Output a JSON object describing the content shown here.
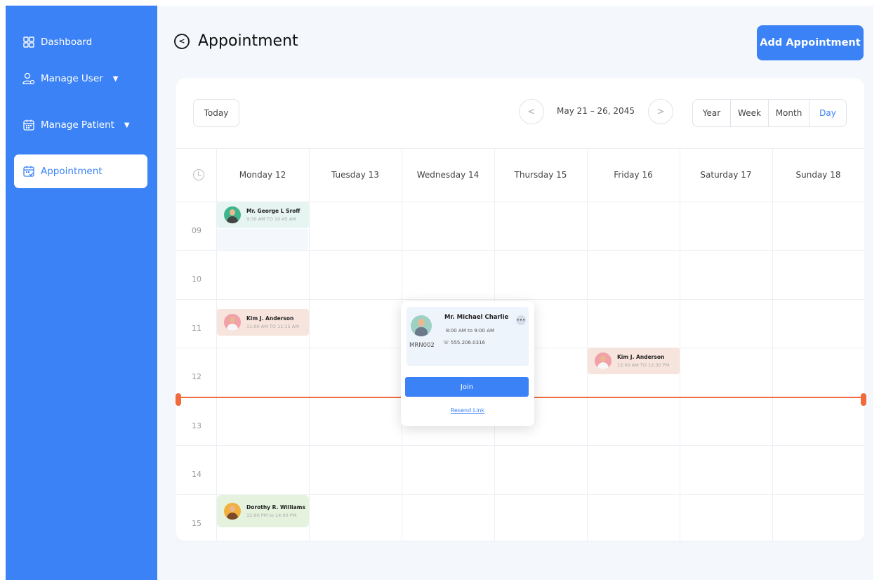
{
  "sidebar": {
    "items": [
      {
        "label": "Dashboard",
        "icon": "dashboard-grid-icon"
      },
      {
        "label": "Manage User",
        "icon": "user-gear-icon",
        "has_chevron": true
      },
      {
        "label": "Manage Patient",
        "icon": "calendar-patient-icon",
        "has_chevron": true
      },
      {
        "label": "Appointment",
        "icon": "calendar-check-icon",
        "active": true
      }
    ]
  },
  "header": {
    "title": "Appointment",
    "add_button": "Add Appointment"
  },
  "toolbar": {
    "today": "Today",
    "date_range": "May 21 – 26, 2045",
    "views": [
      "Year",
      "Week",
      "Month",
      "Day"
    ],
    "selected_view": "Day"
  },
  "calendar": {
    "days": [
      "Monday 12",
      "Tuesday 13",
      "Wednesday 14",
      "Thursday 15",
      "Friday 16",
      "Saturday 17",
      "Sunday 18"
    ],
    "hours": [
      "09",
      "10",
      "11",
      "12",
      "13",
      "14",
      "15"
    ],
    "current_time_hour": "14"
  },
  "appointments": [
    {
      "name": "Mr. George L Sroff",
      "time": "9:30 AM TO 10:45 AM",
      "day": "Monday 12",
      "color": "#e6f5f1"
    },
    {
      "name": "Kim J. Anderson",
      "time": "11:00 AM TO 11:15 AM",
      "day": "Monday 12",
      "color": "#f7e4dc"
    },
    {
      "name": "Kim J. Anderson",
      "time": "12:00 AM TO 12:30 PM",
      "day": "Friday 16",
      "color": "#f7e4dc"
    },
    {
      "name": "Dorothy R. Williams",
      "time": "15:00 PM to 14:00 PM",
      "day": "Monday 12",
      "color": "#e5f3de"
    }
  ],
  "popup": {
    "name": "Mr. Michael Charlie",
    "time": "8:00 AM to 9:00 AM",
    "phone": "555.206.0316",
    "mrn": "MRN002",
    "more": "•••",
    "join": "Join",
    "resend": "Resend Link"
  },
  "colors": {
    "primary": "#3b82f6",
    "now_line": "#f06a3c",
    "background": "#f4f8fc"
  }
}
